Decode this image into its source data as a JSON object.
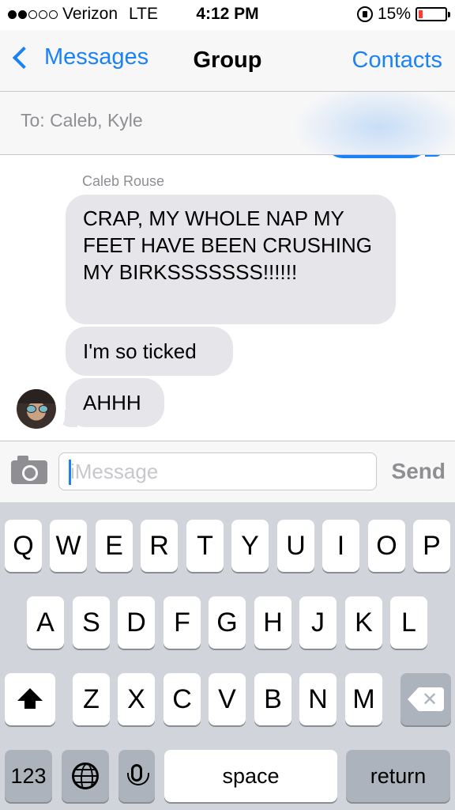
{
  "status_bar": {
    "carrier": "Verizon",
    "network": "LTE",
    "time": "4:12 PM",
    "battery": "15%",
    "battery_level": 0.15,
    "signal_bars_filled": 2,
    "signal_bars_total": 5
  },
  "nav": {
    "back_label": "Messages",
    "title": "Group",
    "contacts_label": "Contacts"
  },
  "recipients": {
    "label": "To: Caleb, Kyle"
  },
  "conversation": {
    "sender": "Caleb Rouse",
    "messages": [
      "CRAP, MY WHOLE NAP MY FEET HAVE BEEN CRUSHING MY BIRKSSSSSSS!!!!!!",
      "I'm so ticked",
      "AHHH"
    ]
  },
  "composer": {
    "placeholder": "iMessage",
    "value": "",
    "send_label": "Send"
  },
  "keyboard": {
    "row1": [
      "Q",
      "W",
      "E",
      "R",
      "T",
      "Y",
      "U",
      "I",
      "O",
      "P"
    ],
    "row2": [
      "A",
      "S",
      "D",
      "F",
      "G",
      "H",
      "J",
      "K",
      "L"
    ],
    "row3": [
      "Z",
      "X",
      "C",
      "V",
      "B",
      "N",
      "M"
    ],
    "numbers_label": "123",
    "space_label": "space",
    "return_label": "return"
  },
  "colors": {
    "accent": "#1a82f7",
    "bubble_gray": "#e5e5ea",
    "battery_low": "#ff3b30",
    "keyboard_bg": "#d1d5db"
  }
}
